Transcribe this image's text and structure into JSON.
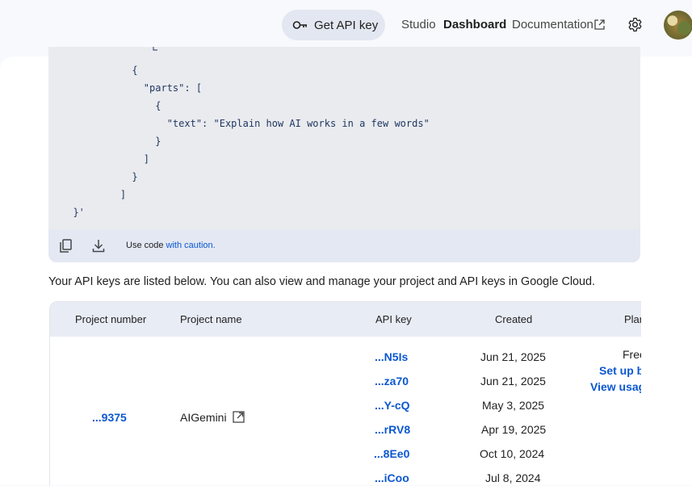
{
  "header": {
    "get_api_key": "Get API key",
    "nav": [
      "Studio",
      "Dashboard",
      "Documentation"
    ]
  },
  "code": {
    "lines": [
      "      {",
      "        \"parts\": [",
      "          {",
      "            \"text\": \"Explain how AI works in a few words\"",
      "          }",
      "        ]",
      "      }",
      "    ]",
      "  }'"
    ],
    "footer_prefix": "Use code ",
    "footer_link": "with caution."
  },
  "intro_text": "Your API keys are listed below. You can also view and manage your project and API keys in Google Cloud.",
  "table": {
    "headers": [
      "Project number",
      "Project name",
      "API key",
      "Created",
      "Plar"
    ],
    "project_number": "...9375",
    "project_name": "AIGemini",
    "keys": [
      {
        "key": "...N5Is",
        "created": "Jun 21, 2025"
      },
      {
        "key": "...za70",
        "created": "Jun 21, 2025"
      },
      {
        "key": "...Y-cQ",
        "created": "May 3, 2025"
      },
      {
        "key": "...rRV8",
        "created": "Apr 19, 2025"
      },
      {
        "key": "...8Ee0",
        "created": "Oct 10, 2024"
      },
      {
        "key": "...iCoo",
        "created": "Jul 8, 2024"
      }
    ],
    "plan": {
      "tier": "Free",
      "setup_billing": "Set up b",
      "view_usage": "View usag"
    }
  },
  "colors": {
    "accent": "#0b57d0",
    "text": "#1f1f1f",
    "code_bg": "#eaebef"
  }
}
